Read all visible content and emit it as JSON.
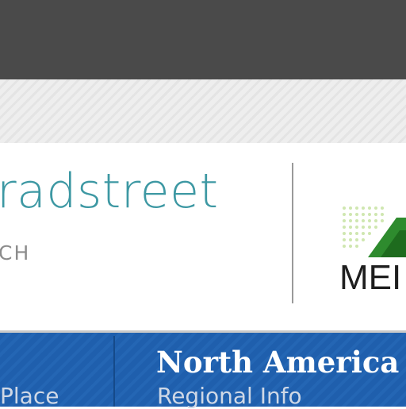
{
  "brand": {
    "name": "radstreet",
    "tagline": "CH"
  },
  "partner": {
    "logo_text": "MEI"
  },
  "nav": {
    "left_item_sub": "Place",
    "item_title": "North America",
    "item_sub": "Regional Info"
  },
  "colors": {
    "top_bar": "#4a4a4a",
    "brand_accent": "#3d98a3",
    "nav_blue": "#1f5fad"
  }
}
